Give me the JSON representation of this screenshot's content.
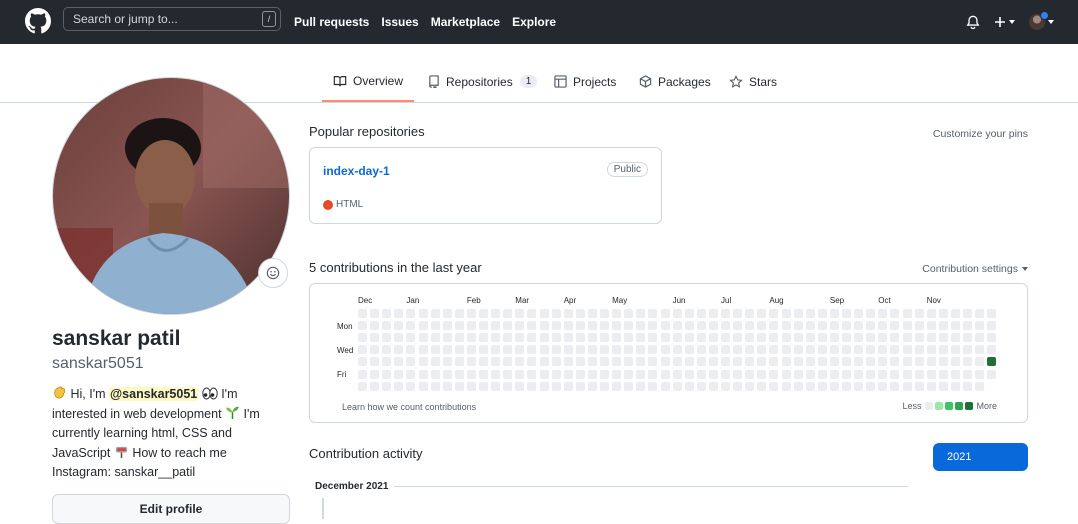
{
  "header": {
    "search_placeholder": "Search or jump to...",
    "search_key": "/",
    "nav": [
      "Pull requests",
      "Issues",
      "Marketplace",
      "Explore"
    ]
  },
  "tabs": [
    {
      "label": "Overview",
      "icon": "book-icon",
      "active": true
    },
    {
      "label": "Repositories",
      "icon": "repo-icon",
      "count": "1"
    },
    {
      "label": "Projects",
      "icon": "project-icon"
    },
    {
      "label": "Packages",
      "icon": "package-icon"
    },
    {
      "label": "Stars",
      "icon": "star-icon"
    }
  ],
  "profile": {
    "full_name": "sanskar patil",
    "username": "sanskar5051",
    "bio": {
      "part1": "Hi, I'm ",
      "mention": "@sanskar5051",
      "part2": " I'm interested in web development ",
      "part3": " I'm currently learning html, CSS and JavaScript ",
      "part4": " How to reach me Instagram: sanskar__patil"
    },
    "edit_label": "Edit profile"
  },
  "popular": {
    "title": "Popular repositories",
    "customize": "Customize your pins",
    "repos": [
      {
        "name": "index-day-1",
        "visibility": "Public",
        "language": "HTML",
        "language_color": "#e34c26"
      }
    ]
  },
  "contributions": {
    "title": "5 contributions in the last year",
    "settings": "Contribution settings",
    "months": [
      "Dec",
      "Jan",
      "Feb",
      "Mar",
      "Apr",
      "May",
      "Jun",
      "Jul",
      "Aug",
      "Sep",
      "Oct",
      "Nov"
    ],
    "weekdays": [
      "Mon",
      "Wed",
      "Fri"
    ],
    "weeks": 53,
    "active_cells": [
      {
        "week": 52,
        "day": 4,
        "level": 4
      }
    ],
    "levels": [
      "#ebedf0",
      "#9be9a8",
      "#40c463",
      "#30a14e",
      "#216e39"
    ],
    "learn": "Learn how we count contributions",
    "less": "Less",
    "more": "More"
  },
  "activity": {
    "title": "Contribution activity",
    "year": "2021",
    "month_heading": "December 2021"
  }
}
